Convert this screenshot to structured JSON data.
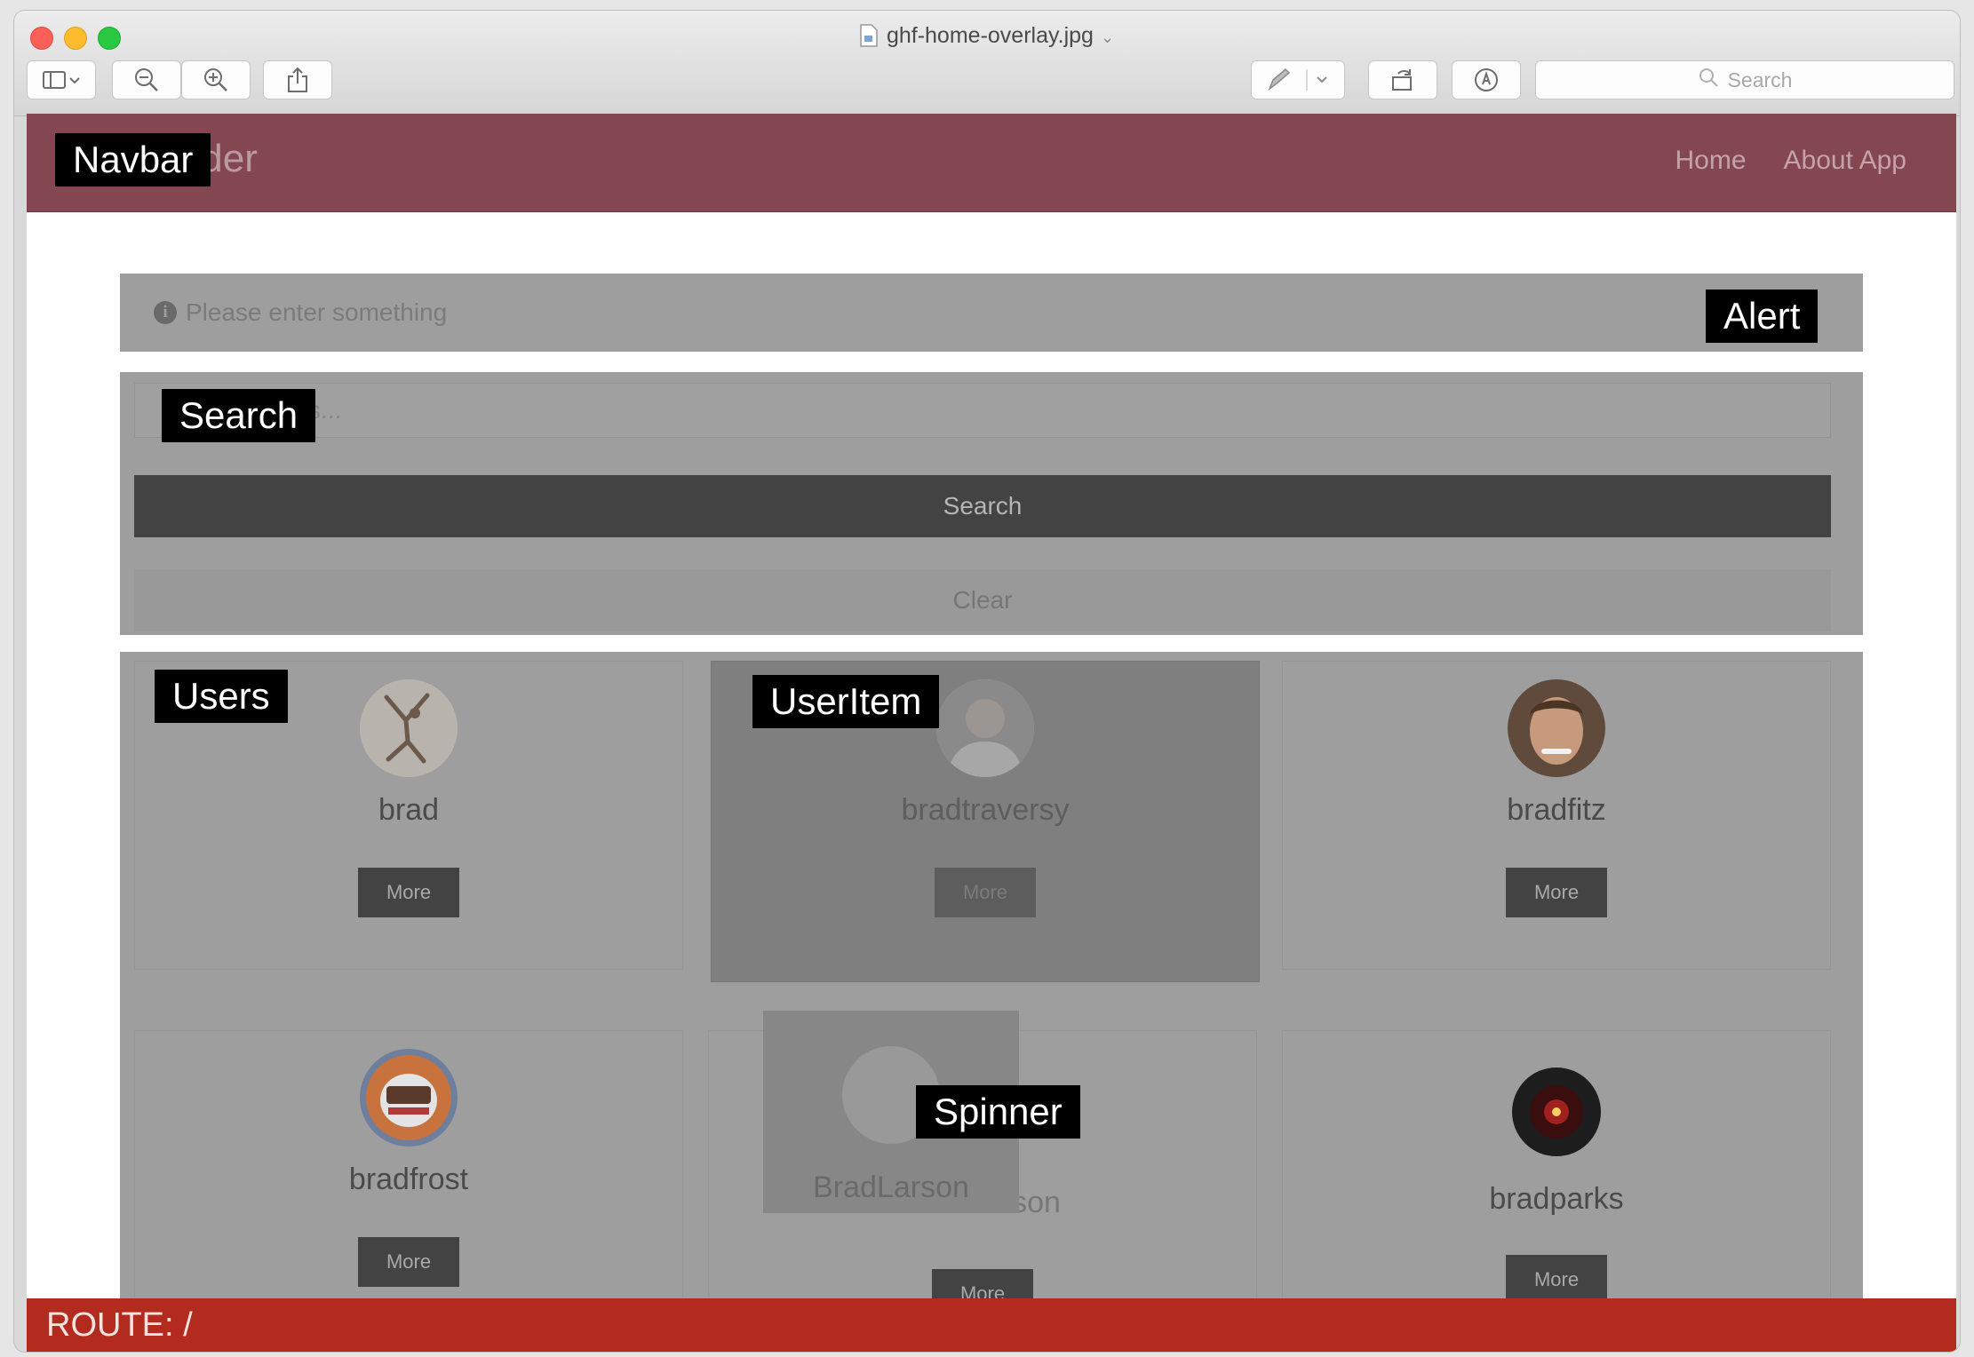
{
  "window": {
    "file_name": "ghf-home-overlay.jpg",
    "search_placeholder": "Search"
  },
  "navbar": {
    "brand_partial": "inder",
    "links": [
      "Home",
      "About App"
    ]
  },
  "alert": {
    "message": "Please enter something"
  },
  "search": {
    "input_placeholder_visible": "ers...",
    "search_button": "Search",
    "clear_button": "Clear"
  },
  "users": [
    {
      "login": "brad",
      "more_label": "More"
    },
    {
      "login": "bradtraversy",
      "more_label": "More"
    },
    {
      "login": "bradfitz",
      "more_label": "More"
    },
    {
      "login": "bradfrost",
      "more_label": "More"
    },
    {
      "login": "BradLarson",
      "more_label": "More"
    },
    {
      "login": "bradparks",
      "more_label": "More"
    }
  ],
  "overlay_labels": {
    "navbar": "Navbar",
    "alert": "Alert",
    "search": "Search",
    "users": "Users",
    "user_item": "UserItem",
    "spinner": "Spinner"
  },
  "route": {
    "text": "ROUTE: /"
  },
  "colors": {
    "navbar_bg": "#844751",
    "route_bar_bg": "#b32a1e",
    "overlay_gray": "#9e9e9e",
    "button_dark": "#434343"
  },
  "icons": [
    "sidebar-toggle-icon",
    "zoom-out-icon",
    "zoom-in-icon",
    "share-icon",
    "markup-pen-icon",
    "rotate-icon",
    "annotate-icon",
    "search-icon",
    "info-icon",
    "document-icon"
  ]
}
